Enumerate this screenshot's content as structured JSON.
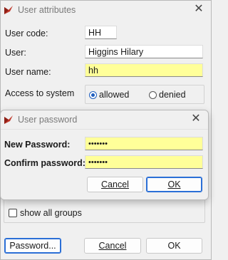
{
  "main": {
    "title": "User attributes",
    "close_glyph": "✕",
    "user_code_label": "User code:",
    "user_code": "HH",
    "user_label": "User:",
    "user": "Higgins Hilary",
    "user_name_label": "User name:",
    "user_name": "hh",
    "access_label": "Access to system",
    "access_options": [
      "allowed",
      "denied"
    ],
    "access_selected": "allowed",
    "show_all_groups": "show all groups",
    "buttons": {
      "password": "Password...",
      "cancel": "Cancel",
      "ok": "OK"
    }
  },
  "dialog": {
    "title": "User password",
    "close_glyph": "✕",
    "new_password_label": "New Password:",
    "new_password": "•••••••",
    "confirm_password_label": "Confirm password:",
    "confirm_password": "•••••••",
    "buttons": {
      "cancel": "Cancel",
      "ok": "OK"
    }
  },
  "colors": {
    "required_field": "#ffff99",
    "accent": "#2b6fd6",
    "app_icon": "#c0392b"
  },
  "icons": {
    "app": "app-logo-icon",
    "close": "close-icon"
  }
}
